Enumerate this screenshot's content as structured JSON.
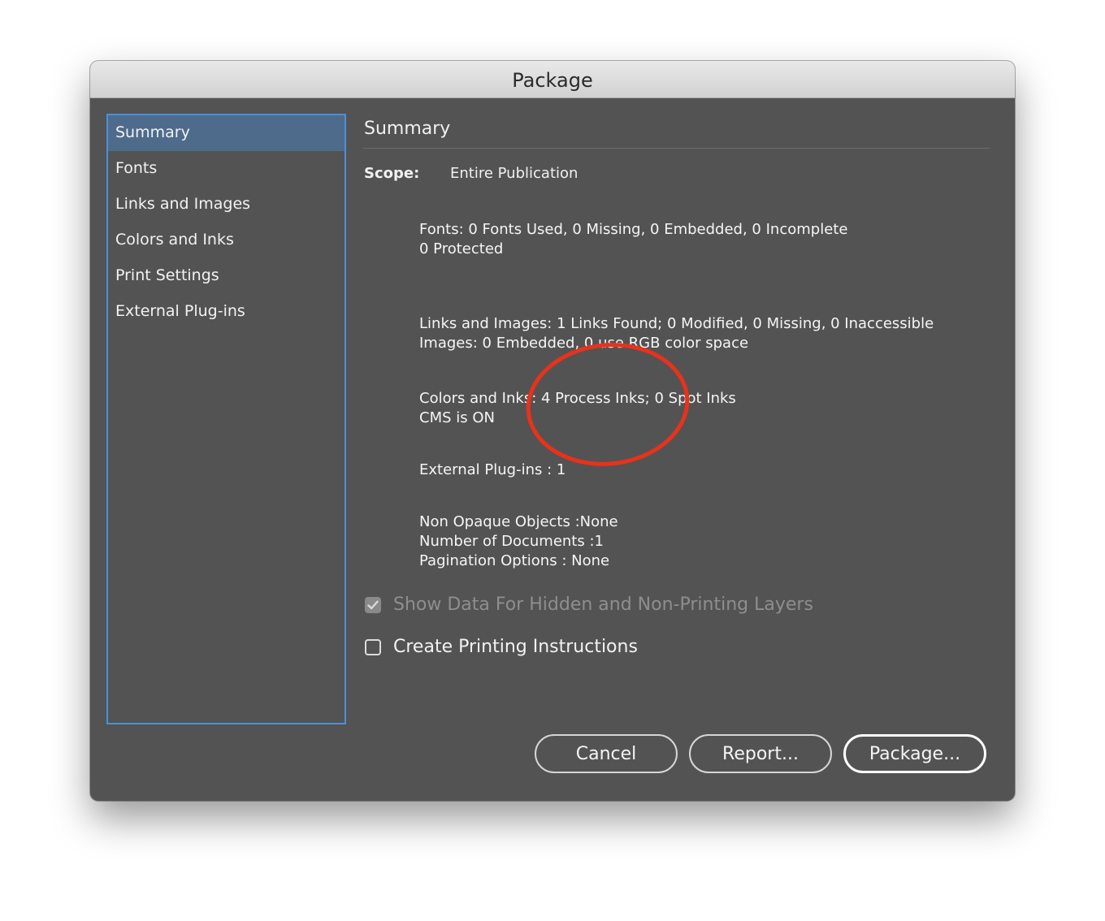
{
  "window": {
    "title": "Package"
  },
  "sidebar": {
    "items": [
      {
        "label": "Summary",
        "selected": true
      },
      {
        "label": "Fonts",
        "selected": false
      },
      {
        "label": "Links and Images",
        "selected": false
      },
      {
        "label": "Colors and Inks",
        "selected": false
      },
      {
        "label": "Print Settings",
        "selected": false
      },
      {
        "label": "External Plug-ins",
        "selected": false
      }
    ]
  },
  "summary": {
    "heading": "Summary",
    "scope_label": "Scope:",
    "scope_value": "Entire Publication",
    "fonts_line1": "Fonts: 0 Fonts Used, 0 Missing, 0 Embedded, 0 Incomplete",
    "fonts_line2": "0 Protected",
    "links_line1": "Links and Images: 1 Links Found; 0 Modified, 0 Missing, 0 Inaccessible",
    "links_line2": "Images: 0 Embedded, 0 use RGB color space",
    "colors_line1": "Colors and Inks: 4 Process Inks; 0 Spot Inks",
    "colors_line2": "CMS is ON",
    "plugins_line": "External Plug-ins : 1",
    "misc_line1": "Non Opaque Objects :None",
    "misc_line2": "Number of Documents :1",
    "misc_line3": "Pagination Options : None"
  },
  "options": {
    "show_hidden_label": "Show Data For Hidden and Non-Printing Layers",
    "show_hidden_checked": true,
    "show_hidden_enabled": false,
    "create_instructions_label": "Create Printing Instructions",
    "create_instructions_checked": false
  },
  "buttons": {
    "cancel": "Cancel",
    "report": "Report...",
    "package": "Package..."
  },
  "colors": {
    "dialog_bg": "#535353",
    "selection": "#4e6b8c",
    "focus_ring": "#4a90d9",
    "annotation": "#e8321c"
  },
  "icons": {
    "checkmark": "checkmark-icon"
  }
}
